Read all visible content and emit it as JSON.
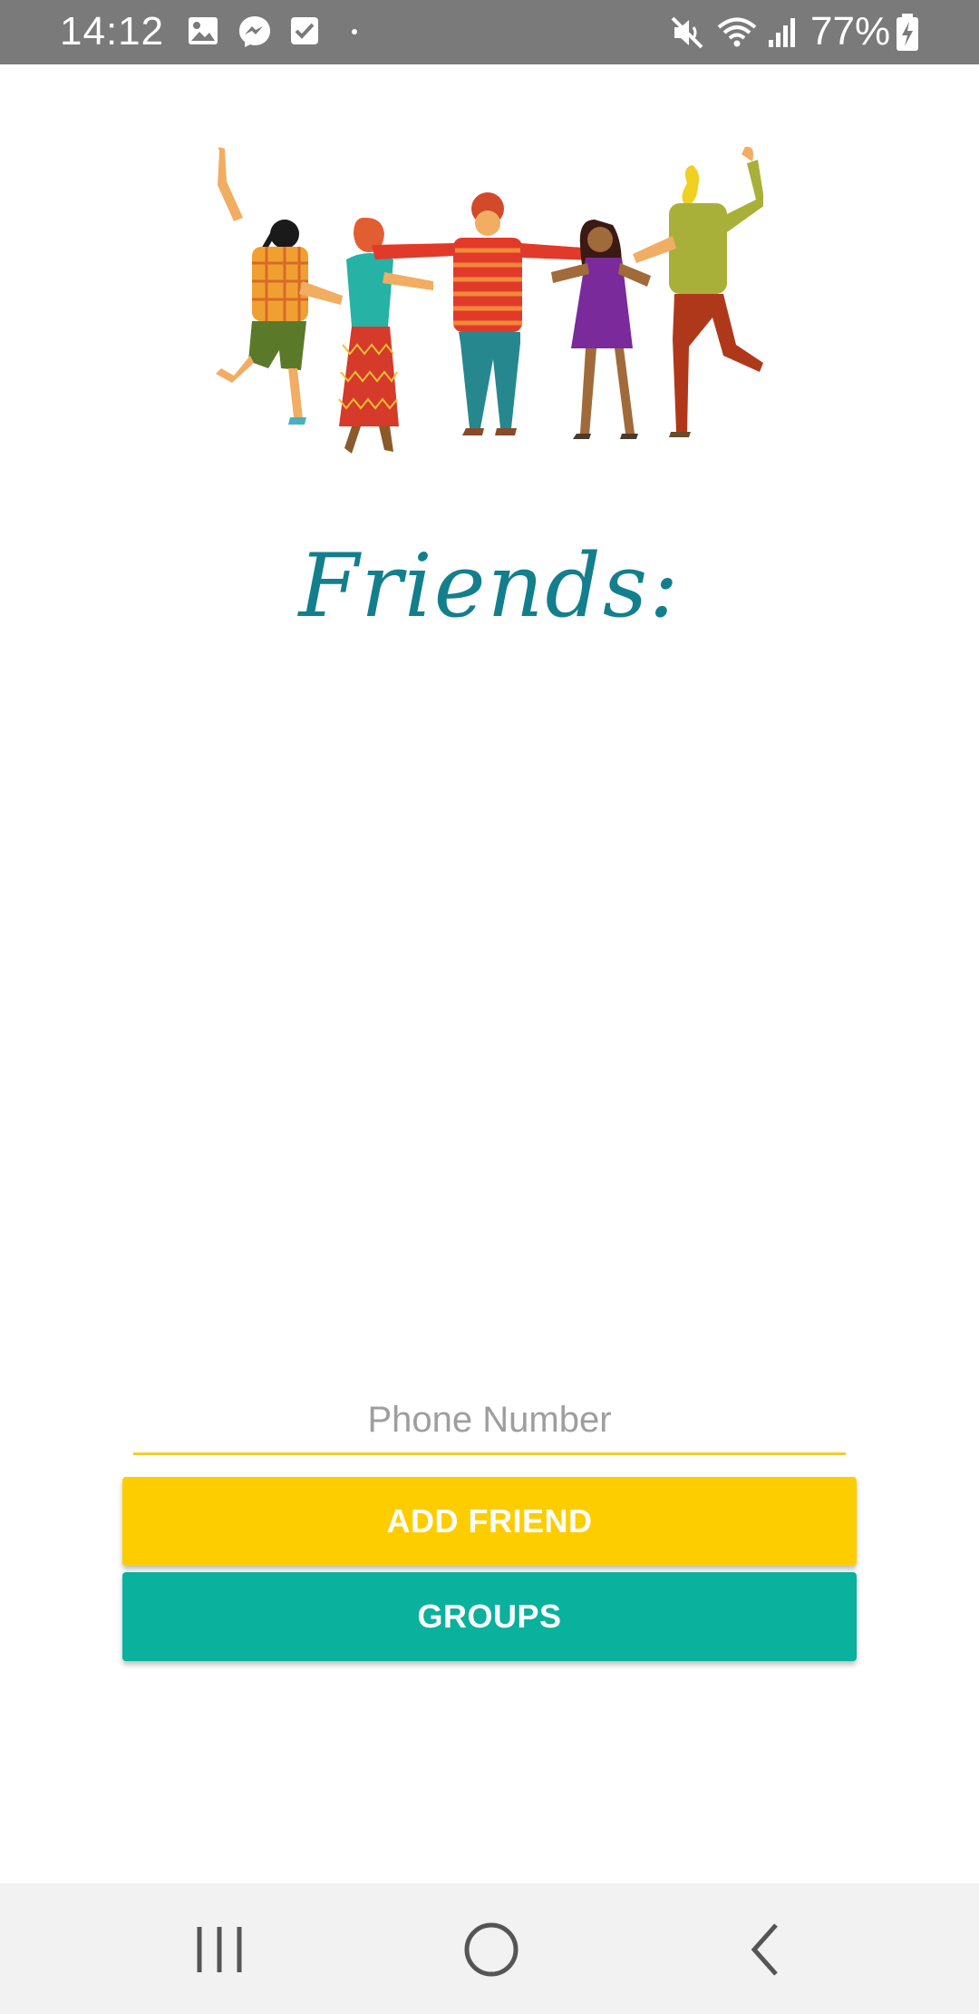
{
  "status_bar": {
    "time": "14:12",
    "battery": "77%",
    "icons": [
      "gallery-icon",
      "messenger-icon",
      "checkbox-icon",
      "dot-icon",
      "mute-icon",
      "wifi-icon",
      "signal-icon",
      "battery-icon"
    ],
    "background": "#7a7a7a"
  },
  "main": {
    "illustration": "dancing-friends-illustration",
    "title": "Friends:",
    "title_color": "#137f8c"
  },
  "form": {
    "phone_placeholder": "Phone Number",
    "phone_value": "",
    "underline_color": "#f2cf2a"
  },
  "buttons": {
    "add_friend": "ADD FRIEND",
    "add_friend_color": "#fecd00",
    "groups": "GROUPS",
    "groups_color": "#0ab19d"
  },
  "nav_bar": {
    "items": [
      "recent-apps-icon",
      "home-icon",
      "back-icon"
    ]
  }
}
